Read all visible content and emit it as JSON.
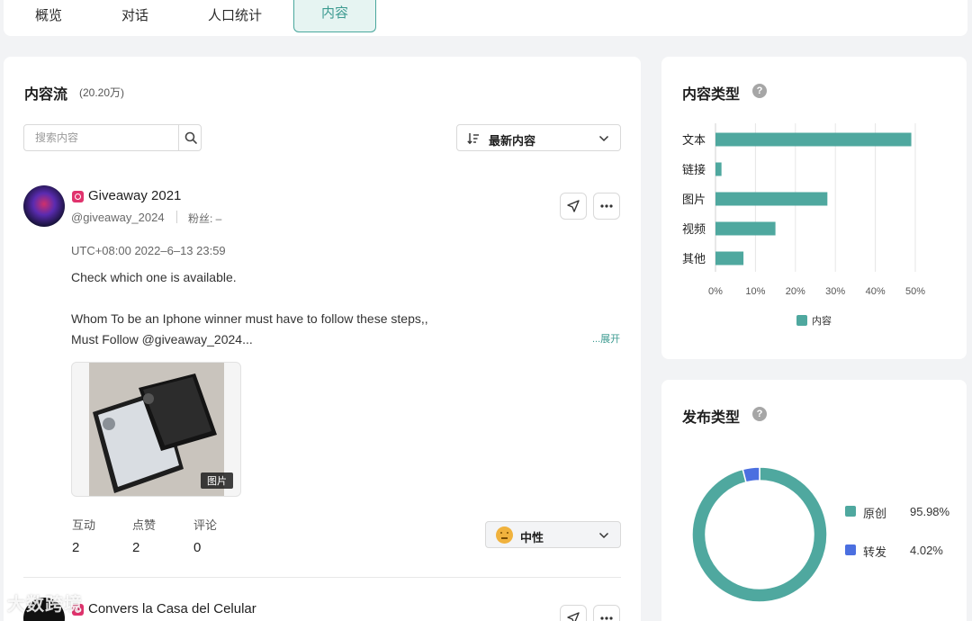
{
  "tabs": [
    {
      "label": "概览"
    },
    {
      "label": "对话"
    },
    {
      "label": "人口统计"
    },
    {
      "label": "内容"
    }
  ],
  "feed": {
    "title": "内容流",
    "count": "(20.20万)",
    "search_placeholder": "搜索内容",
    "sort_label": "最新内容",
    "expand_label": "...展开",
    "post": {
      "name": "Giveaway 2021",
      "handle": "@giveaway_2024",
      "fans": "粉丝: –",
      "time": "UTC+08:00 2022–6–13 23:59",
      "body": [
        "Check which one is available.",
        "",
        "Whom To be an Iphone winner must have to follow these steps,,",
        "Must Follow @giveaway_2024..."
      ],
      "image_badge": "图片",
      "stats": [
        {
          "label": "互动",
          "value": "2"
        },
        {
          "label": "点赞",
          "value": "2"
        },
        {
          "label": "评论",
          "value": "0"
        }
      ],
      "sentiment": "中性"
    },
    "post2": {
      "name": "Convers la Casa del Celular"
    },
    "watermark": "大数跨境"
  },
  "content_type": {
    "title": "内容类型",
    "help": "?"
  },
  "publish_type": {
    "title": "发布类型",
    "help": "?",
    "legend": [
      {
        "label": "原创",
        "value": "95.98%",
        "color": "#4fa89f"
      },
      {
        "label": "转发",
        "value": "4.02%",
        "color": "#4b6fe0"
      }
    ]
  },
  "chart_data": [
    {
      "type": "bar",
      "orientation": "horizontal",
      "categories": [
        "文本",
        "链接",
        "图片",
        "视频",
        "其他"
      ],
      "series": [
        {
          "name": "内容",
          "values": [
            49,
            1.5,
            28,
            15,
            7
          ]
        }
      ],
      "xlim": [
        0,
        50
      ],
      "xticks": [
        "0%",
        "10%",
        "20%",
        "30%",
        "40%",
        "50%"
      ],
      "grid": true,
      "legend": "bottom",
      "color": "#4fa89f"
    },
    {
      "type": "pie",
      "donut": true,
      "categories": [
        "原创",
        "转发"
      ],
      "values": [
        95.98,
        4.02
      ],
      "colors": [
        "#4fa89f",
        "#4b6fe0"
      ],
      "legend": "right"
    }
  ]
}
